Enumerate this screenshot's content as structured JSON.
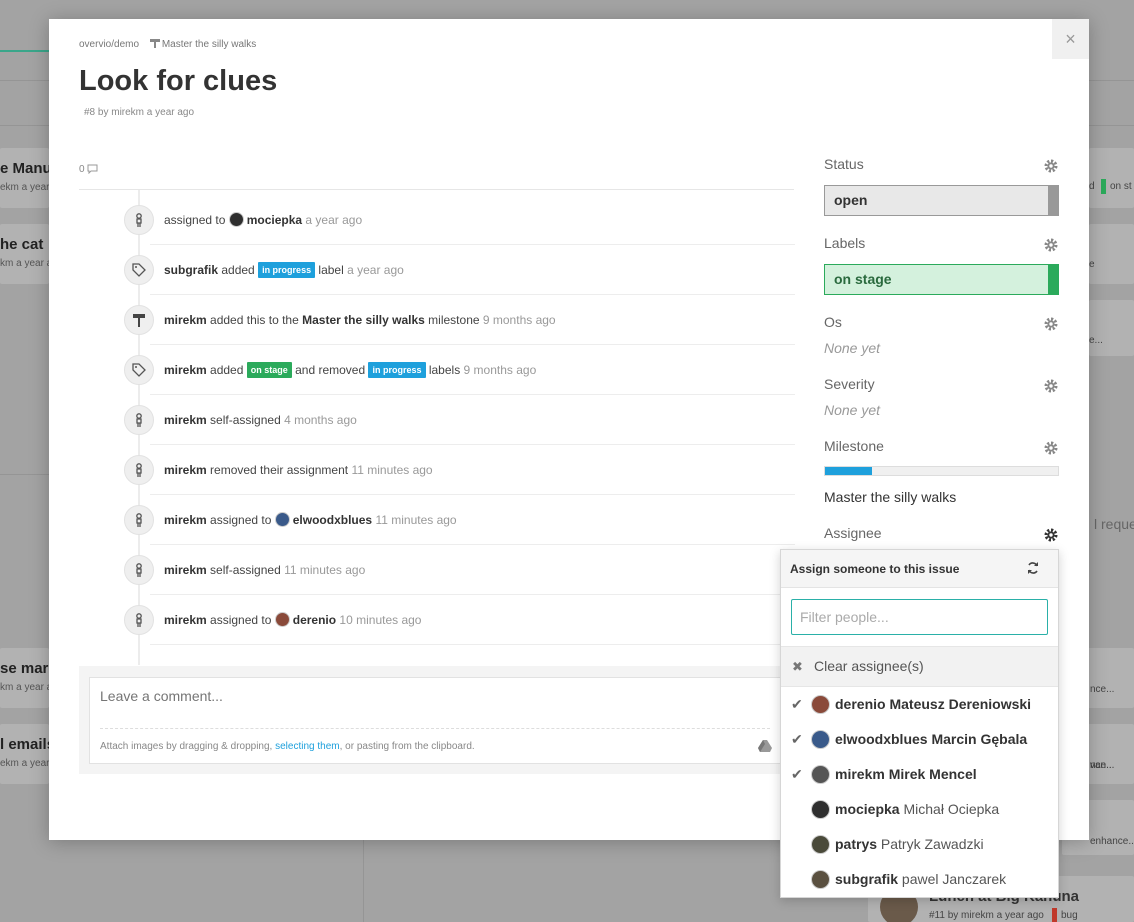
{
  "background": {
    "cards_left": [
      {
        "title": "e Manue",
        "sub": "ekm a year"
      },
      {
        "title": "he cat",
        "sub": "km a year a"
      },
      {
        "title": "se marke",
        "sub": "km a year a"
      },
      {
        "title": "l emails",
        "sub": "ekm a year"
      }
    ],
    "cards_right": [
      {
        "text": "d",
        "tag": "on st"
      },
      {
        "text": "e",
        "tag": ""
      },
      {
        "text": "e...",
        "tag": ""
      },
      {
        "text": "l reques",
        "tag": ""
      },
      {
        "text": "nce...",
        "tag": ""
      },
      {
        "text": "nce...",
        "tag": ""
      },
      {
        "text": "van...",
        "tag": ""
      },
      {
        "text": "enhance...",
        "tag": ""
      }
    ],
    "bottom_card": {
      "title": "Lunch at Big Kahuna",
      "sub": "#11 by mirekm a year ago",
      "tag": "bug"
    }
  },
  "modal": {
    "close_label": "×",
    "breadcrumb_repo": "overvio/demo",
    "breadcrumb_milestone": "Master the silly walks",
    "title": "Look for clues",
    "byline": "#8 by mirekm a year ago",
    "comment_count": "0"
  },
  "events": [
    {
      "icon": "person-icon",
      "parts": [
        [
          "t",
          "assigned to "
        ],
        [
          "av",
          "mociepka"
        ],
        [
          "b",
          "mociepka"
        ],
        [
          "ago",
          " a year ago"
        ]
      ]
    },
    {
      "icon": "tag-icon",
      "parts": [
        [
          "b",
          "subgrafik"
        ],
        [
          "t",
          " added "
        ],
        [
          "lbl",
          "in progress",
          "#1ea0dc"
        ],
        [
          "t",
          " label"
        ],
        [
          "ago",
          " a year ago"
        ]
      ]
    },
    {
      "icon": "milestone-icon",
      "parts": [
        [
          "b",
          "mirekm"
        ],
        [
          "t",
          " added this to the "
        ],
        [
          "b",
          "Master the silly walks"
        ],
        [
          "t",
          " milestone"
        ],
        [
          "ago",
          " 9 months ago"
        ]
      ]
    },
    {
      "icon": "tag-icon",
      "parts": [
        [
          "b",
          "mirekm"
        ],
        [
          "t",
          " added "
        ],
        [
          "lbl",
          "on stage",
          "#2baa5b"
        ],
        [
          "t",
          " and removed "
        ],
        [
          "lbl",
          "in progress",
          "#1ea0dc"
        ],
        [
          "t",
          " labels"
        ],
        [
          "ago",
          " 9 months ago"
        ]
      ]
    },
    {
      "icon": "person-icon",
      "parts": [
        [
          "b",
          "mirekm"
        ],
        [
          "t",
          " self-assigned"
        ],
        [
          "ago",
          " 4 months ago"
        ]
      ]
    },
    {
      "icon": "person-icon",
      "parts": [
        [
          "b",
          "mirekm"
        ],
        [
          "t",
          " removed their assignment"
        ],
        [
          "ago",
          " 11 minutes ago"
        ]
      ]
    },
    {
      "icon": "person-icon",
      "parts": [
        [
          "b",
          "mirekm"
        ],
        [
          "t",
          " assigned to "
        ],
        [
          "av",
          "elwoodxblues"
        ],
        [
          "b",
          "elwoodxblues"
        ],
        [
          "ago",
          " 11 minutes ago"
        ]
      ]
    },
    {
      "icon": "person-icon",
      "parts": [
        [
          "b",
          "mirekm"
        ],
        [
          "t",
          " self-assigned"
        ],
        [
          "ago",
          " 11 minutes ago"
        ]
      ]
    },
    {
      "icon": "person-icon",
      "parts": [
        [
          "b",
          "mirekm"
        ],
        [
          "t",
          " assigned to "
        ],
        [
          "av",
          "derenio"
        ],
        [
          "b",
          "derenio"
        ],
        [
          "ago",
          " 10 minutes ago"
        ]
      ]
    }
  ],
  "comment": {
    "placeholder": "Leave a comment...",
    "attach_before": "Attach images by dragging & dropping, ",
    "attach_link": "selecting them",
    "attach_after": ", or pasting from the clipboard."
  },
  "sidebar": {
    "status_label": "Status",
    "status_value": "open",
    "labels_label": "Labels",
    "labels_value": "on stage",
    "os_label": "Os",
    "os_value": "None yet",
    "severity_label": "Severity",
    "severity_value": "None yet",
    "milestone_label": "Milestone",
    "milestone_progress": 0.2,
    "milestone_name": "Master the silly walks",
    "assignee_label": "Assignee"
  },
  "dropdown": {
    "title": "Assign someone to this issue",
    "filter_placeholder": "Filter people...",
    "clear_label": "Clear assignee(s)",
    "people": [
      {
        "login": "derenio",
        "name": "Mateusz Dereniowski",
        "selected": true
      },
      {
        "login": "elwoodxblues",
        "name": "Marcin Gębala",
        "selected": true
      },
      {
        "login": "mirekm",
        "name": "Mirek Mencel",
        "selected": true
      },
      {
        "login": "mociepka",
        "name": "Michał Ociepka",
        "selected": false
      },
      {
        "login": "patrys",
        "name": "Patryk Zawadzki",
        "selected": false
      },
      {
        "login": "subgrafik",
        "name": "pawel Janczarek",
        "selected": false
      }
    ]
  },
  "colors": {
    "accent": "#1ea0dc",
    "on_stage": "#2baa5b",
    "status_bar": "#999999"
  }
}
